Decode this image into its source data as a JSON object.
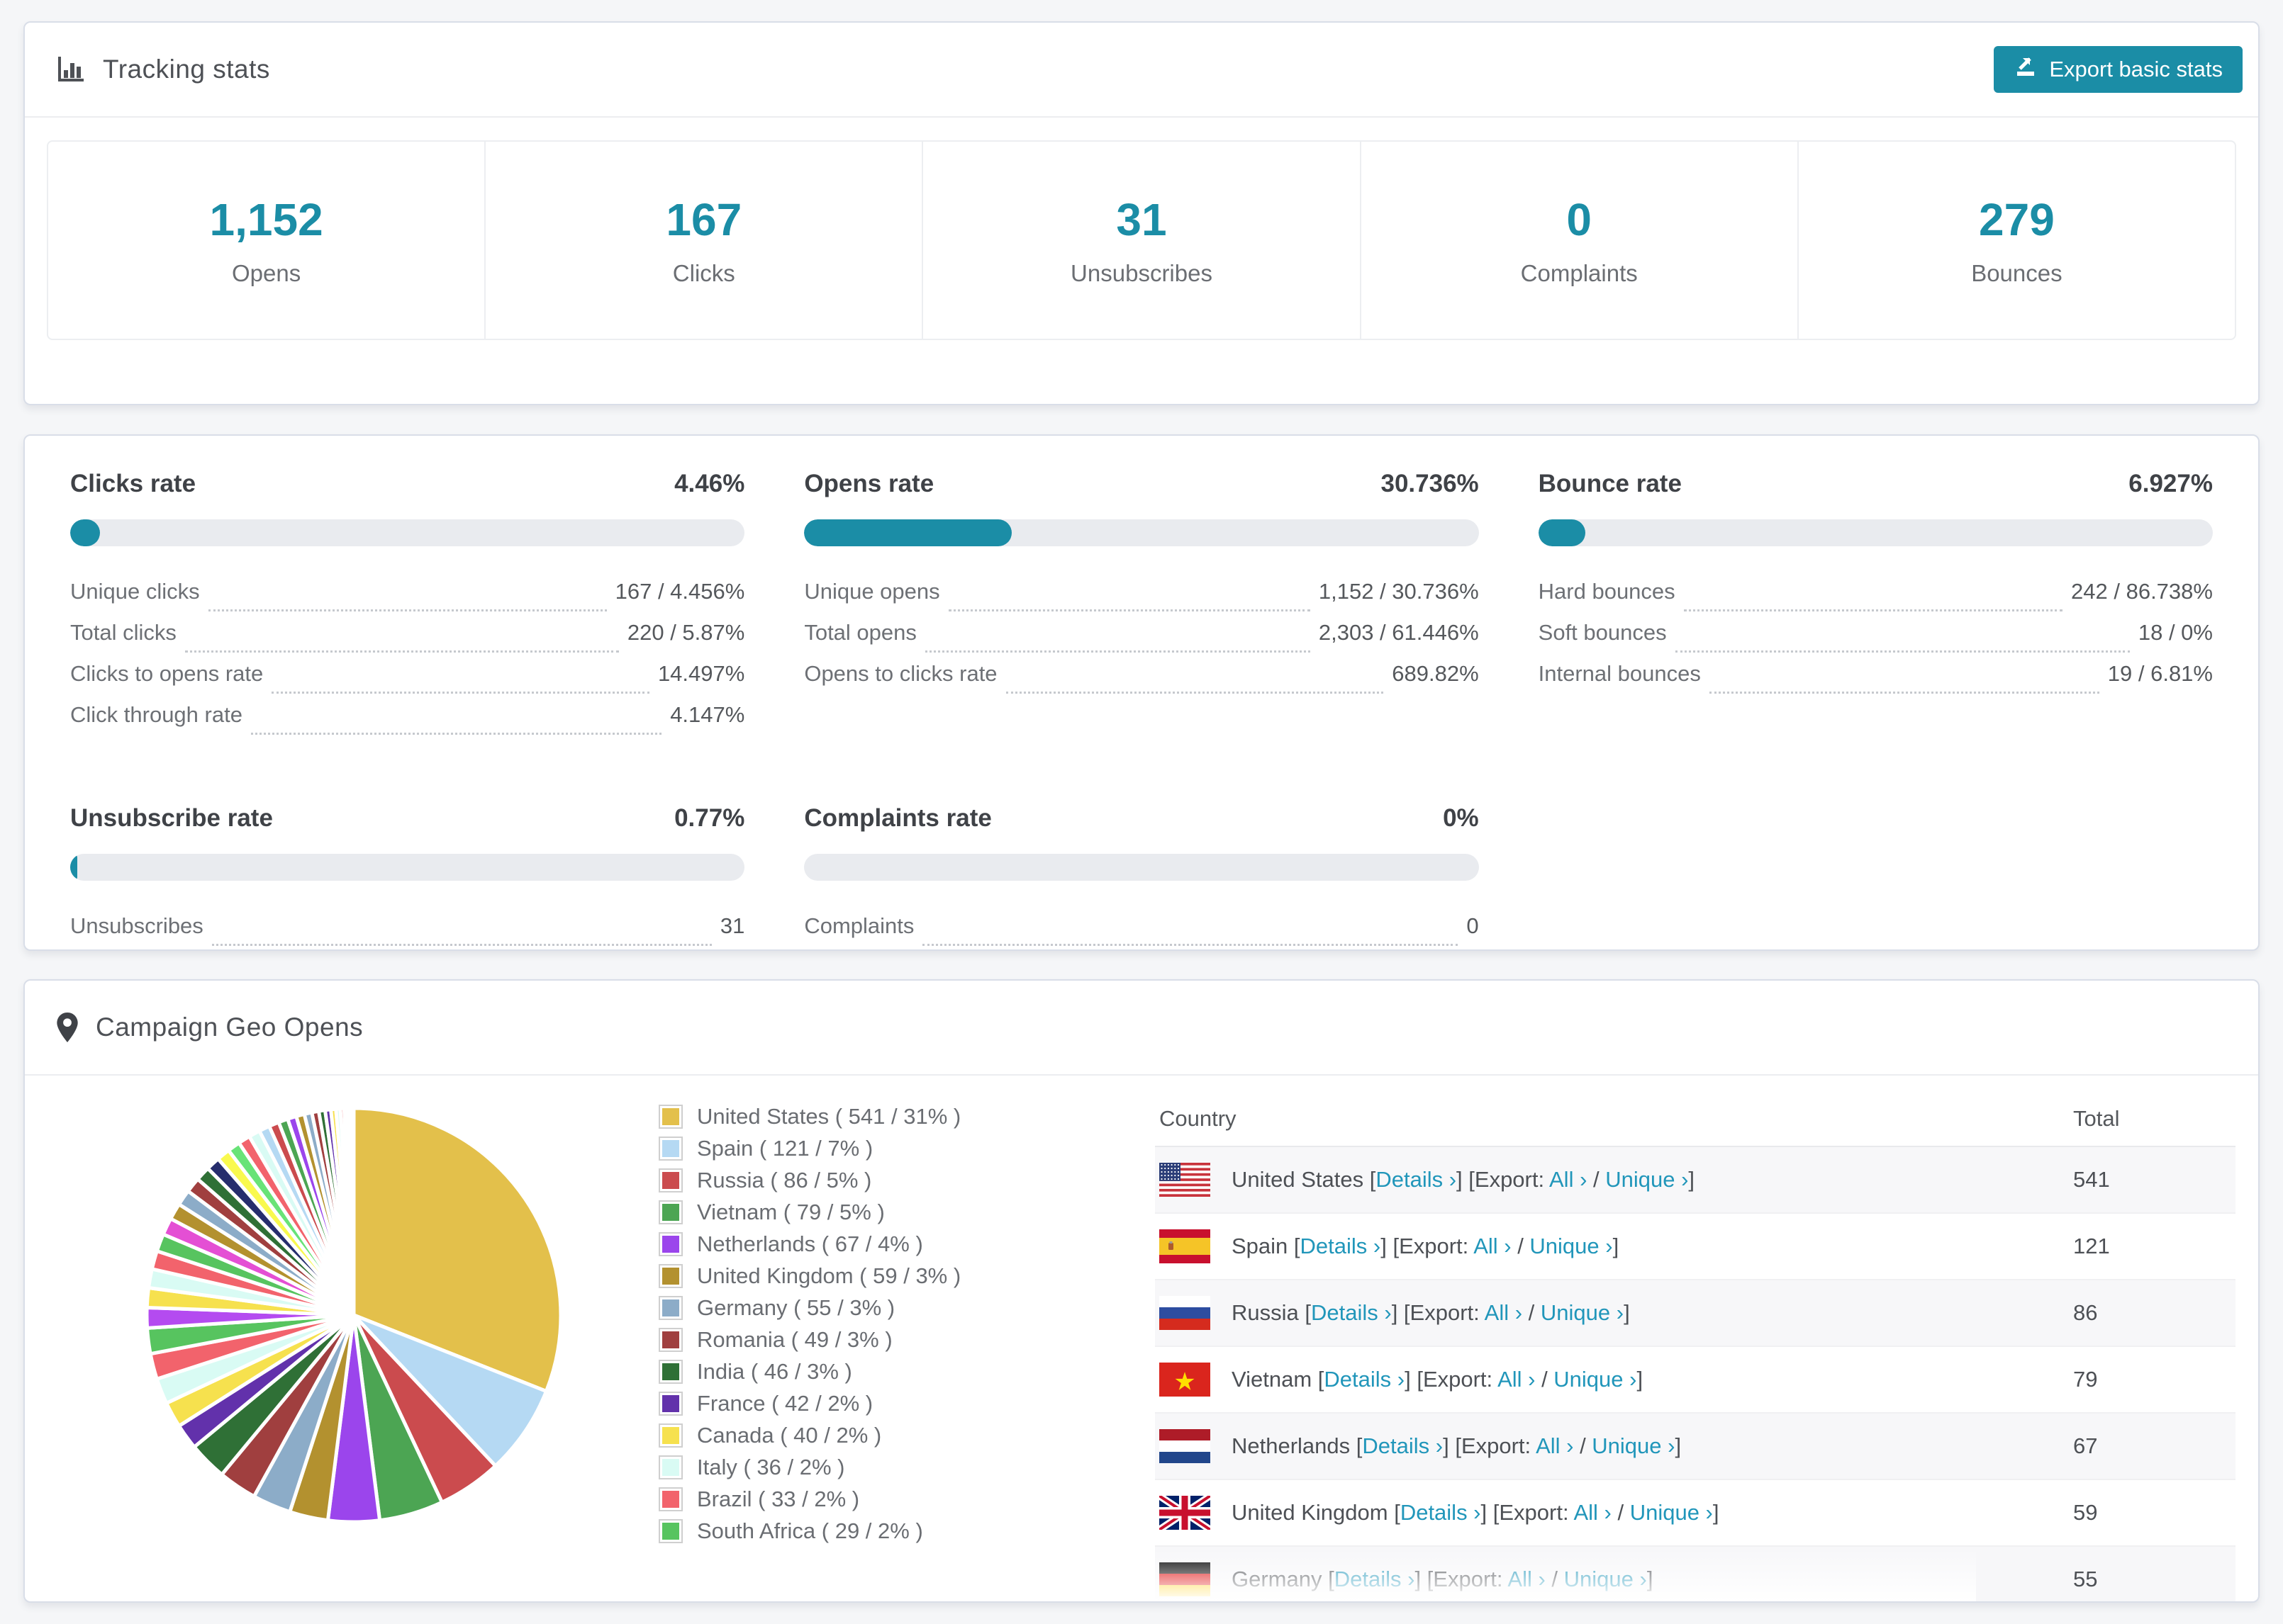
{
  "accent": "#1b8da6",
  "link_color": "#2196ba",
  "tracking": {
    "title": "Tracking stats",
    "export_button": "Export basic stats",
    "stats": [
      {
        "value": "1,152",
        "label": "Opens"
      },
      {
        "value": "167",
        "label": "Clicks"
      },
      {
        "value": "31",
        "label": "Unsubscribes"
      },
      {
        "value": "0",
        "label": "Complaints"
      },
      {
        "value": "279",
        "label": "Bounces"
      }
    ]
  },
  "rates": {
    "blocks": [
      {
        "title": "Clicks rate",
        "value": "4.46%",
        "pct": 4.46,
        "rows": [
          {
            "label": "Unique clicks",
            "value": "167 / 4.456%"
          },
          {
            "label": "Total clicks",
            "value": "220 / 5.87%"
          },
          {
            "label": "Clicks to opens rate",
            "value": "14.497%"
          },
          {
            "label": "Click through rate",
            "value": "4.147%"
          }
        ]
      },
      {
        "title": "Opens rate",
        "value": "30.736%",
        "pct": 30.736,
        "rows": [
          {
            "label": "Unique opens",
            "value": "1,152 / 30.736%"
          },
          {
            "label": "Total opens",
            "value": "2,303 / 61.446%"
          },
          {
            "label": "Opens to clicks rate",
            "value": "689.82%"
          }
        ]
      },
      {
        "title": "Bounce rate",
        "value": "6.927%",
        "pct": 6.927,
        "rows": [
          {
            "label": "Hard bounces",
            "value": "242 / 86.738%"
          },
          {
            "label": "Soft bounces",
            "value": "18 / 0%"
          },
          {
            "label": "Internal bounces",
            "value": "19 / 6.81%"
          }
        ]
      },
      {
        "title": "Unsubscribe rate",
        "value": "0.77%",
        "pct": 0.77,
        "rows": [
          {
            "label": "Unsubscribes",
            "value": "31"
          }
        ]
      },
      {
        "title": "Complaints rate",
        "value": "0%",
        "pct": 0,
        "rows": [
          {
            "label": "Complaints",
            "value": "0"
          }
        ]
      }
    ]
  },
  "geo": {
    "title": "Campaign Geo Opens",
    "table": {
      "columns": [
        "Country",
        "Total"
      ],
      "details_label": "Details",
      "export_label": "Export:",
      "all_label": "All",
      "unique_label": "Unique",
      "chevron": "›",
      "rows": [
        {
          "country": "United States",
          "flag": "us",
          "total": "541"
        },
        {
          "country": "Spain",
          "flag": "es",
          "total": "121"
        },
        {
          "country": "Russia",
          "flag": "ru",
          "total": "86"
        },
        {
          "country": "Vietnam",
          "flag": "vn",
          "total": "79"
        },
        {
          "country": "Netherlands",
          "flag": "nl",
          "total": "67"
        },
        {
          "country": "United Kingdom",
          "flag": "gb",
          "total": "59"
        },
        {
          "country": "Germany",
          "flag": "de",
          "total": "55",
          "partially_visible": true
        }
      ]
    }
  },
  "chart_data": {
    "type": "pie",
    "title": "Campaign Geo Opens",
    "legend_position": "right-of-pie",
    "labels": [
      "United States",
      "Spain",
      "Russia",
      "Vietnam",
      "Netherlands",
      "United Kingdom",
      "Germany",
      "Romania",
      "India",
      "France",
      "Canada",
      "Italy",
      "Brazil",
      "South Africa"
    ],
    "values": [
      541,
      121,
      86,
      79,
      67,
      59,
      55,
      49,
      46,
      42,
      40,
      36,
      33,
      29
    ],
    "pct": [
      31,
      7,
      5,
      5,
      4,
      3,
      3,
      3,
      3,
      2,
      2,
      2,
      2,
      2
    ],
    "colors": [
      "#e3c04b",
      "#b5d9f3",
      "#cb4b4e",
      "#4ca553",
      "#9b45ec",
      "#b3912f",
      "#8cacc8",
      "#a03f3f",
      "#2f7036",
      "#6231ab",
      "#f6e14e",
      "#d9fbf4",
      "#f2636c",
      "#57c45f"
    ],
    "legend_visible_count": 14,
    "others": {
      "pct_total": 26,
      "slice_count": 32,
      "palette": [
        "#b44bf0",
        "#f6e14e",
        "#d9fbf4",
        "#f2636c",
        "#57c45f",
        "#e44fd4",
        "#b3912f",
        "#8cacc8",
        "#a03f3f",
        "#2f7036",
        "#262d6d",
        "#f9f94e",
        "#68e377",
        "#f2636c",
        "#d9fbf4",
        "#b5d9f3",
        "#cb4b4e",
        "#4ca553",
        "#9b45ec",
        "#b3912f",
        "#8cacc8",
        "#a03f3f",
        "#2f7036",
        "#6231ab",
        "#f6e14e",
        "#d9fbf4",
        "#f2636c",
        "#57c45f",
        "#e44fd4",
        "#262d6d",
        "#cb4b4e",
        "#4ca553"
      ]
    }
  }
}
